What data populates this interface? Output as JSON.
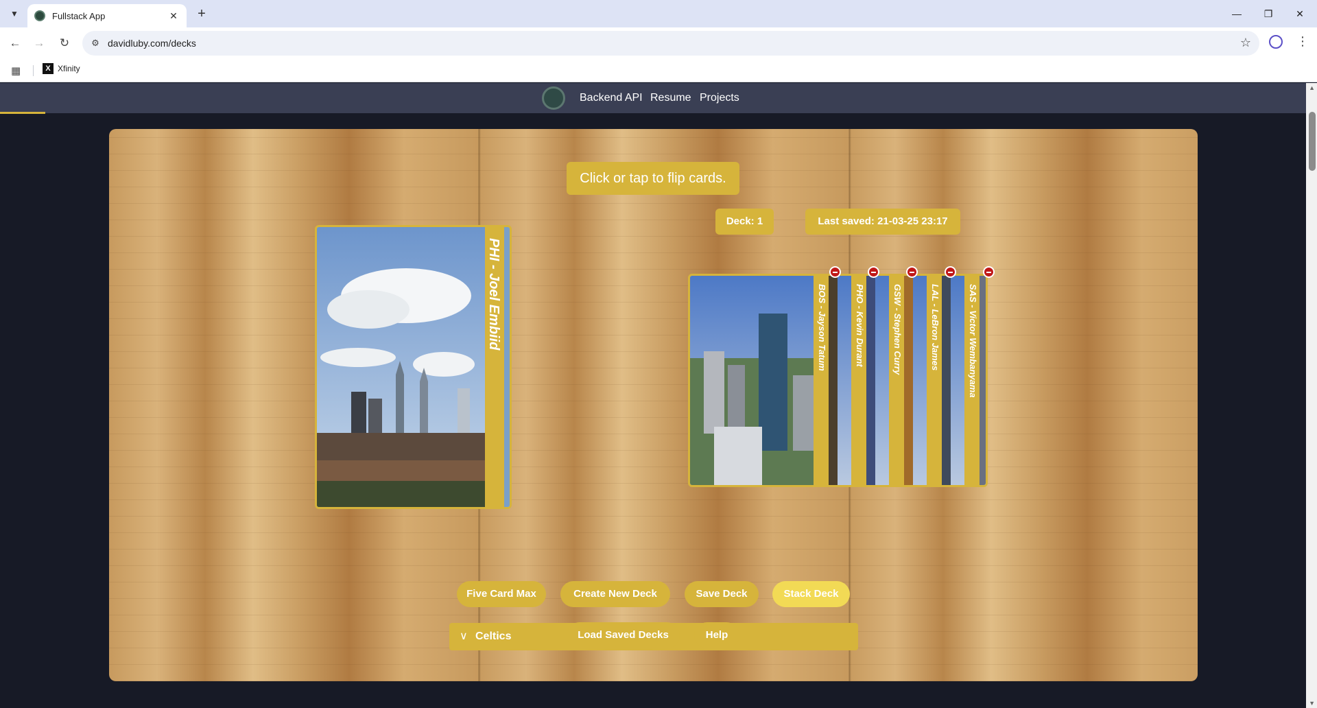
{
  "browser": {
    "tab_title": "Fullstack App",
    "tab_close": "✕",
    "new_tab": "+",
    "url": "davidluby.com/decks",
    "bookmarks": [
      {
        "label": "Xfinity",
        "icon": "x-logo"
      }
    ],
    "controls": {
      "minimize": "—",
      "maximize": "❐",
      "close": "✕"
    }
  },
  "site": {
    "nav": {
      "links": [
        "Backend API",
        "Resume",
        "Projects"
      ]
    }
  },
  "decks": {
    "hint": "Click or tap to flip cards.",
    "deck_badge": "Deck: 1",
    "saved_badge": "Last saved: 21-03-25 23:17",
    "active_card": {
      "label": "PHI - Joel Embiid"
    },
    "stack_cards": [
      {
        "label": "BOS - Jayson Tatum"
      },
      {
        "label": "PHO - Kevin Durant"
      },
      {
        "label": "GSW - Stephen Curry"
      },
      {
        "label": "LAL - LeBron James"
      },
      {
        "label": "SAS - Victor Wembanyama"
      }
    ],
    "team_select": {
      "value": "Celtics"
    },
    "buttons": {
      "five_card_max": "Five Card Max",
      "create_new_deck": "Create New Deck",
      "save_deck": "Save Deck",
      "stack_deck": "Stack Deck",
      "load_saved_decks": "Load Saved Decks",
      "help": "Help"
    }
  },
  "colors": {
    "accent": "#d6b43b",
    "accent_active": "#f2da55",
    "nav": "#3a3f54",
    "background": "#171a26"
  }
}
